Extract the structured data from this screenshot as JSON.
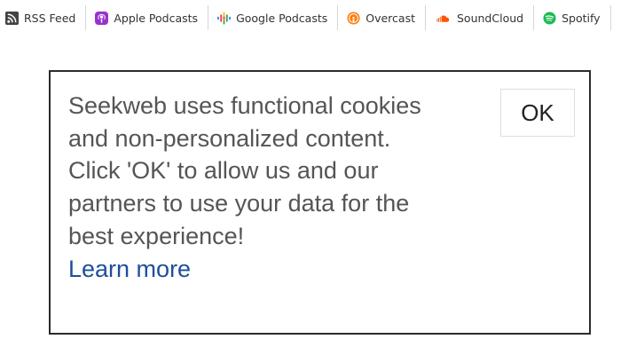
{
  "podcast_bar": {
    "items": [
      {
        "label": "RSS Feed",
        "icon": "rss-icon"
      },
      {
        "label": "Apple Podcasts",
        "icon": "apple-podcasts-icon"
      },
      {
        "label": "Google Podcasts",
        "icon": "google-podcasts-icon"
      },
      {
        "label": "Overcast",
        "icon": "overcast-icon"
      },
      {
        "label": "SoundCloud",
        "icon": "soundcloud-icon"
      },
      {
        "label": "Spotify",
        "icon": "spotify-icon"
      }
    ]
  },
  "cookie_notice": {
    "message": "Seekweb uses functional cookies and non-personalized content. Click 'OK' to allow us and our partners to use your data for the best experience!",
    "learn_more": "Learn more",
    "ok_label": "OK"
  },
  "colors": {
    "apple_podcasts": "#9933cc",
    "overcast": "#fc7e0f",
    "soundcloud": "#ff5500",
    "spotify": "#1db954",
    "link": "#1f4e9a",
    "message_text": "#555555"
  }
}
